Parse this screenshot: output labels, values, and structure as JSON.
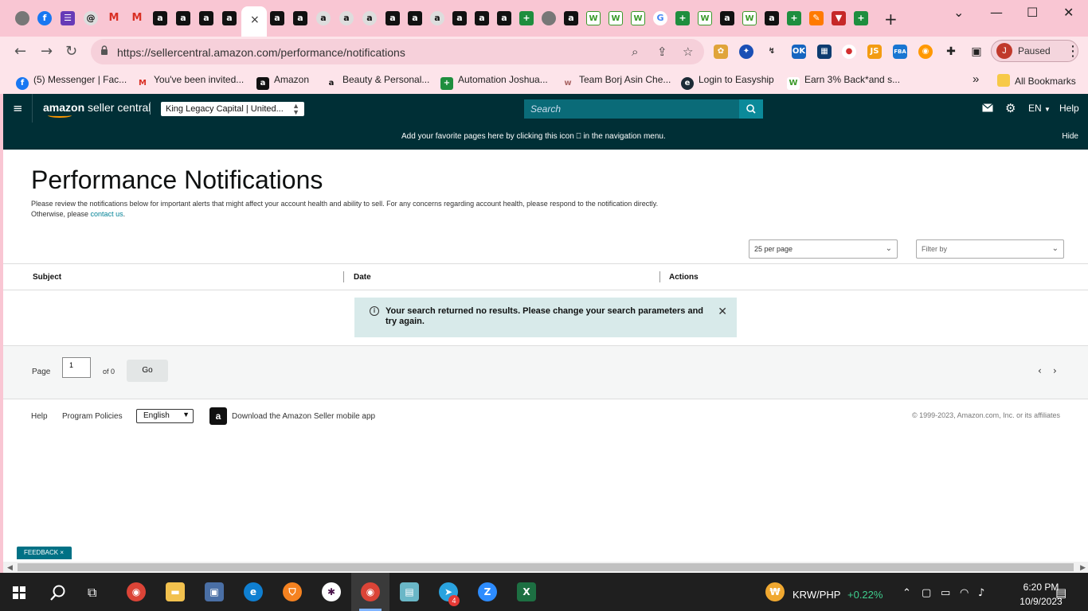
{
  "browser": {
    "url": "https://sellercentral.amazon.com/performance/notifications",
    "profile_initial": "J",
    "profile_status": "Paused",
    "new_tab": "+",
    "tab_close": "×",
    "bookmarks": [
      {
        "label": "(5) Messenger | Fac...",
        "icon": "messenger-icon",
        "color": "#1877f2"
      },
      {
        "label": "You've been invited...",
        "icon": "gmail-icon",
        "color": "#d93025"
      },
      {
        "label": "Amazon",
        "icon": "amazon-icon",
        "color": "#111111"
      },
      {
        "label": "Beauty & Personal...",
        "icon": "amazon-icon",
        "color": "#111111"
      },
      {
        "label": "Automation Joshua...",
        "icon": "sheets-icon",
        "color": "#1e8e3e"
      },
      {
        "label": "Team Borj Asin Che...",
        "icon": "team-icon",
        "color": "#bbbbbb"
      },
      {
        "label": "Login to Easyship",
        "icon": "easyship-icon",
        "color": "#1c2b36"
      },
      {
        "label": "Earn 3% Back*and s...",
        "icon": "wz-icon",
        "color": "#3a9a2a"
      }
    ],
    "bookmarks_overflow": "»",
    "all_bookmarks": "All Bookmarks"
  },
  "seller_central": {
    "logo_bold": "amazon",
    "logo_rest": " seller central",
    "account_selector": "King Legacy Capital | United...",
    "search_placeholder": "Search",
    "language": "EN",
    "help": "Help",
    "favorites_message": "Add your favorite pages here by clicking this icon ⎕ in the navigation menu.",
    "favorites_hide": "Hide"
  },
  "page": {
    "title": "Performance Notifications",
    "description_1": "Please review the notifications below for important alerts that might affect your account health and ability to sell. For any concerns regarding account health, please respond to the notification directly.",
    "description_2": "Otherwise, please ",
    "contact_link": "contact us",
    "description_end": ".",
    "per_page": "25 per page",
    "filter_placeholder": "Filter by",
    "columns": [
      "Subject",
      "Date",
      "Actions"
    ],
    "alert_message": "Your search returned no results. Please change your search parameters and try again.",
    "pager": {
      "label": "Page",
      "value": "1",
      "of": "of 0",
      "go": "Go"
    },
    "footer": {
      "help": "Help",
      "program_policies": "Program Policies",
      "language_option": "English",
      "download_app": "Download the Amazon Seller mobile app",
      "copyright": "© 1999-2023, Amazon.com, Inc. or its affiliates"
    },
    "feedback": "FEEDBACK ×"
  },
  "taskbar": {
    "ticker_pair": "KRW/PHP",
    "ticker_change": "+0.22%",
    "time": "6:20 PM",
    "date": "10/9/2023",
    "telegram_badge": "4"
  }
}
